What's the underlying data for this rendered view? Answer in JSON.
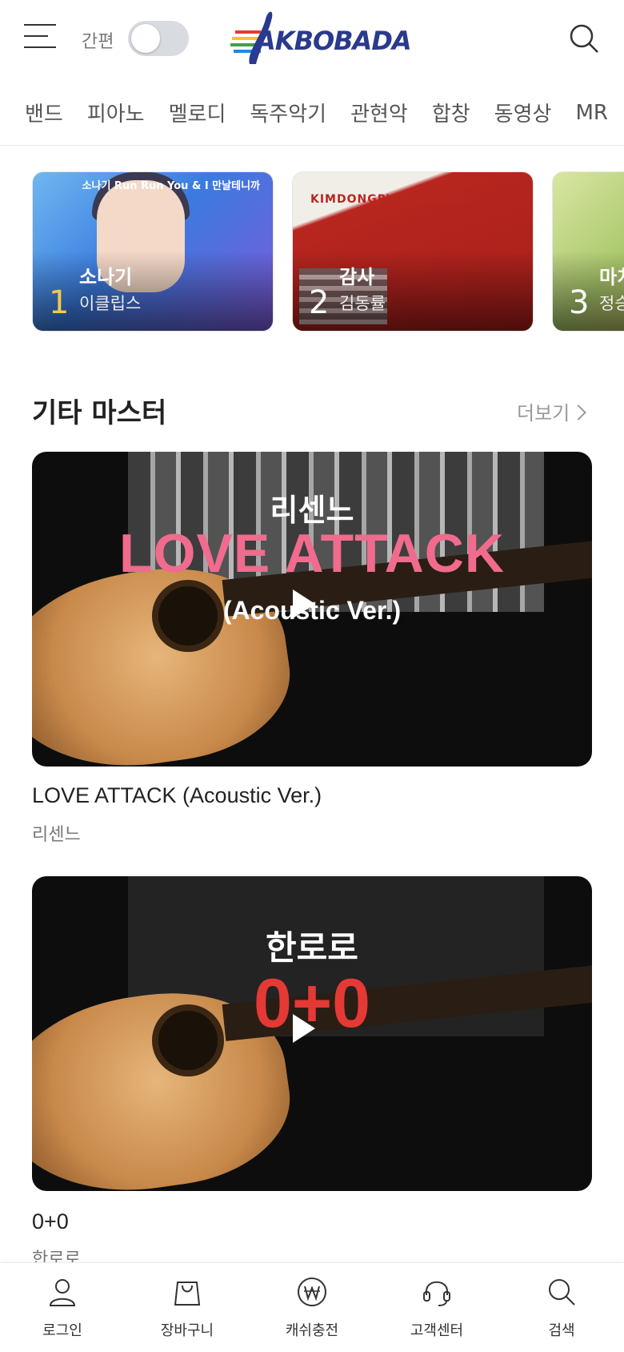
{
  "header": {
    "simple_label": "간편",
    "logo_text": "AKBOBADA",
    "toggle_on": false
  },
  "categories": [
    "밴드",
    "피아노",
    "멜로디",
    "독주악기",
    "관현악",
    "합창",
    "동영상",
    "MR"
  ],
  "charts": [
    {
      "rank": "1",
      "title": "소나기",
      "artist": "이클립스",
      "art_text": "소나기 Run Run You & I 만날테니까"
    },
    {
      "rank": "2",
      "title": "감사",
      "artist": "김동률",
      "art_text": "KIMDONGRYUL THANKS"
    },
    {
      "rank": "3",
      "title": "마치",
      "artist": "정승"
    }
  ],
  "section": {
    "title": "기타 마스터",
    "more": "더보기"
  },
  "videos": [
    {
      "overlay_artist": "리센느",
      "overlay_song": "LOVE ATTACK",
      "overlay_sub": "(Acoustic Ver.)",
      "title": "LOVE ATTACK (Acoustic Ver.)",
      "artist": "리센느"
    },
    {
      "overlay_artist": "한로로",
      "overlay_song": "0+0",
      "title": "0+0",
      "artist": "한로로"
    }
  ],
  "bottom_nav": [
    {
      "label": "로그인",
      "icon": "user-icon"
    },
    {
      "label": "장바구니",
      "icon": "shopping-bag-icon"
    },
    {
      "label": "캐쉬충전",
      "icon": "won-coin-icon"
    },
    {
      "label": "고객센터",
      "icon": "headset-icon"
    },
    {
      "label": "검색",
      "icon": "search-icon"
    }
  ],
  "colors": {
    "logo": "#2a3a8c",
    "rank_gold": "#f2c94c",
    "text_muted": "#777777"
  }
}
